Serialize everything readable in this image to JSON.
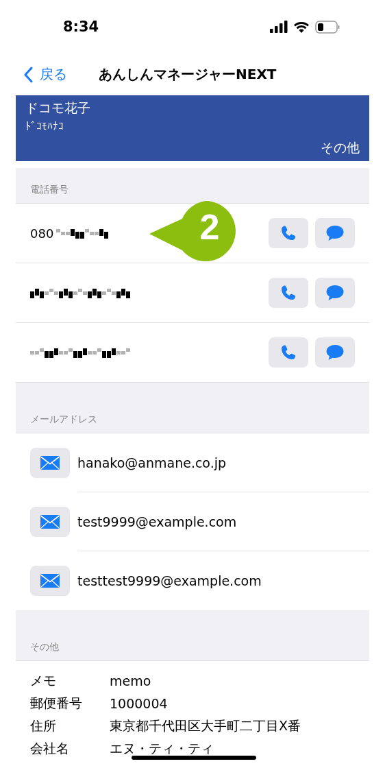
{
  "status_bar": {
    "time": "8:34"
  },
  "nav": {
    "back": "戻る",
    "title": "あんしんマネージャーNEXT"
  },
  "contact": {
    "name": "ドコモ花子",
    "kana": "ﾄﾞｺﾓﾊﾅｺ",
    "group": "その他"
  },
  "phone_section": {
    "label": "電話番号",
    "numbers": [
      {
        "prefix": "080",
        "redacted": true
      },
      {
        "redacted": true
      },
      {
        "redacted": true
      }
    ]
  },
  "callout": {
    "text": "2"
  },
  "email_section": {
    "label": "メールアドレス",
    "addresses": [
      "hanako@anmane.co.jp",
      "test9999@example.com",
      "testtest9999@example.com"
    ]
  },
  "other_section": {
    "label": "その他",
    "rows": [
      {
        "label": "メモ",
        "value": "memo"
      },
      {
        "label": "郵便番号",
        "value": "1000004"
      },
      {
        "label": "住所",
        "value": "東京都千代田区大手町二丁目X番"
      },
      {
        "label": "会社名",
        "value": "エヌ・ティ・ティ"
      }
    ]
  }
}
